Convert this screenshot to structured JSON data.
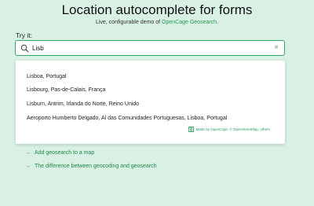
{
  "header": {
    "title": "Location autocomplete for forms",
    "subtitle_prefix": "Live, configurable demo of ",
    "subtitle_link": "OpenCage Geosearch",
    "subtitle_suffix": "."
  },
  "search": {
    "label": "Try it:",
    "value": "Lisb",
    "clear_symbol": "×"
  },
  "results": [
    "Lisboa, Portugal",
    "Lisbourg, Pas-de-Calais, França",
    "Lisburn, Antrim, Irlanda do Norte, Reino Unido",
    "Aeroporto Humberto Delgado, Al das Comunidades Portuguesas, Lisboa, Portugal"
  ],
  "attribution": "Made by OpenCage. © OpenStreetMap, others.",
  "links": [
    {
      "arrow": "→",
      "label": "Add geosearch to a map"
    },
    {
      "arrow": "→",
      "label": "The difference between geocoding and geosearch"
    }
  ],
  "colors": {
    "background": "#d8f1e4",
    "accent": "#2b9a5c"
  }
}
